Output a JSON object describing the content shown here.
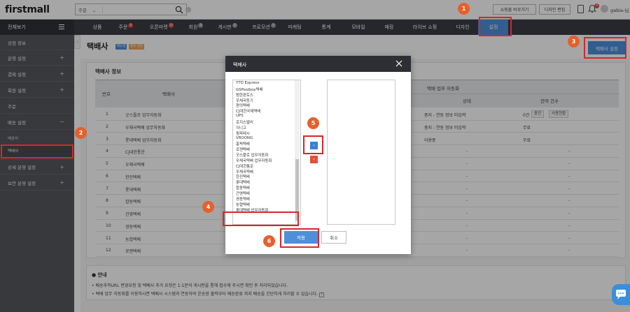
{
  "header": {
    "logo": "firstmall",
    "search_select": "주문",
    "store_button": "쇼핑몰 바로가기",
    "design_button": "디자인 편집",
    "notif_count": "9",
    "username": "gabia-님"
  },
  "nav": {
    "all_menu": "전체보기",
    "items": [
      {
        "label": "상품",
        "badge": ""
      },
      {
        "label": "주문",
        "badge": "8"
      },
      {
        "label": "오픈마켓",
        "badge": "10"
      },
      {
        "label": "회원",
        "badge": "0"
      },
      {
        "label": "게시판",
        "badge": "0"
      },
      {
        "label": "프로모션",
        "badge": "0"
      },
      {
        "label": "마케팅",
        "badge": ""
      },
      {
        "label": "통계",
        "badge": ""
      },
      {
        "label": "모바일",
        "badge": ""
      },
      {
        "label": "매장",
        "badge": ""
      },
      {
        "label": "라이브 쇼핑",
        "badge": ""
      },
      {
        "label": "디자인",
        "badge": ""
      },
      {
        "label": "설정",
        "badge": ""
      }
    ]
  },
  "sidebar": {
    "items": [
      "상점 정보",
      "운영 설정",
      "결제 설정",
      "회원 설정",
      "주문",
      "배송 설정",
      "상세 운영 설정",
      "보안 운영 설정"
    ],
    "sub_items": [
      "배송비",
      "택배사"
    ]
  },
  "page": {
    "title": "택배사",
    "tag1": "메뉴얼",
    "tag2": "필수 설정",
    "carrier_button": "택배사 설정",
    "panel_title": "택배사 정보"
  },
  "table": {
    "headers": {
      "no": "번호",
      "carrier": "택배사",
      "auto_group": "택배 업무 자동화",
      "status": "상태",
      "balance": "잔여 건수"
    },
    "rows": [
      {
        "no": "1",
        "name": "굿스플로 업무자동화",
        "status": "중지 - 연동 정보 미입력",
        "balance": "0건",
        "b1": "충전",
        "b2": "사용현황"
      },
      {
        "no": "2",
        "name": "우체국택배 업무자동화",
        "status": "중지 - 연동 정보 미입력",
        "balance": "무료",
        "b1": "",
        "b2": ""
      },
      {
        "no": "3",
        "name": "롯데택배 업무자동화",
        "status": "이용중",
        "balance": "무료",
        "b1": "",
        "b2": ""
      },
      {
        "no": "4",
        "name": "CJ대한통운",
        "status": "-",
        "balance": "-",
        "b1": "",
        "b2": ""
      },
      {
        "no": "5",
        "name": "우체국택배",
        "status": "-",
        "balance": "-",
        "b1": "",
        "b2": ""
      },
      {
        "no": "6",
        "name": "한진택배",
        "status": "-",
        "balance": "-",
        "b1": "",
        "b2": ""
      },
      {
        "no": "7",
        "name": "롯데택배",
        "status": "-",
        "balance": "-",
        "b1": "",
        "b2": ""
      },
      {
        "no": "8",
        "name": "합동택배",
        "status": "-",
        "balance": "-",
        "b1": "",
        "b2": ""
      },
      {
        "no": "9",
        "name": "건영택배",
        "status": "-",
        "balance": "-",
        "b1": "",
        "b2": ""
      },
      {
        "no": "10",
        "name": "경동택배",
        "status": "-",
        "balance": "-",
        "b1": "",
        "b2": ""
      },
      {
        "no": "11",
        "name": "농협택배",
        "status": "-",
        "balance": "-",
        "b1": "",
        "b2": ""
      },
      {
        "no": "12",
        "name": "로젠택배",
        "status": "-",
        "balance": "-",
        "b1": "",
        "b2": ""
      }
    ]
  },
  "notice": {
    "title": "안내",
    "lines": [
      "배송추적URL 변경요청 및 택배사 추가 요청은 1:1문의 게시판을 통해 접수해 주시면 확인 후 처리되었습니다.",
      "택배 업무 자동화를 이용하시면 택배사 시스템과 연동하여 운송장 출력부터 배송완료 까지 배송을 간단하게 처리할 수 있습니다."
    ]
  },
  "modal": {
    "title": "택배사",
    "options": [
      "YTD Express",
      "GSPostbox택배",
      "범한판토스",
      "우체국등기",
      "편의택배",
      "CJ대한국제택배",
      "UPS",
      "로지스밸리",
      "지니고",
      "핑퍼레시",
      "VROONG",
      "홈픽택배",
      "로젠택배",
      "굿스플로 업무자동화",
      "우체국택배 업무자동화",
      "CJ대한통운",
      "우체국택배",
      "한진택배",
      "롯데택배",
      "합동택배",
      "건영택배",
      "경동택배",
      "농협택배",
      "롯데택배 업무자동화"
    ],
    "add_arrow": "›",
    "remove_arrow": "‹",
    "apply": "적용",
    "cancel": "취소"
  },
  "annotations": [
    "1",
    "2",
    "3",
    "4",
    "5",
    "6"
  ]
}
